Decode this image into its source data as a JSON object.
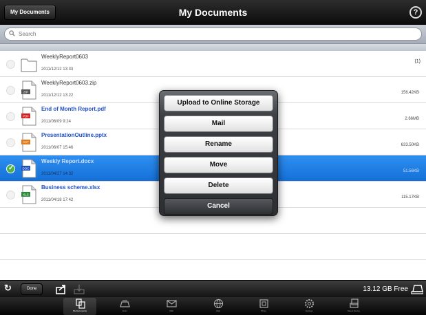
{
  "header": {
    "back_label": "My Documents",
    "title": "My Documents",
    "help_label": "?"
  },
  "search": {
    "placeholder": "Search"
  },
  "files": [
    {
      "name": "WeeklyReport0603",
      "date": "2011/12/12 13:33",
      "size": "",
      "count": "(1)",
      "type": "folder",
      "icon": "folder-icon",
      "selected": false
    },
    {
      "name": "WeeklyReport0603.zip",
      "date": "2011/12/12 13:22",
      "size": "156.42KB",
      "type": "zip",
      "badge": "ZIP",
      "icon": "zip-file-icon",
      "selected": false
    },
    {
      "name": "End of Month Report.pdf",
      "date": "2011/06/09 9:24",
      "size": "2.66MB",
      "type": "pdf",
      "badge": "PDF",
      "icon": "pdf-file-icon",
      "selected": false
    },
    {
      "name": "PresentationOutline.pptx",
      "date": "2011/06/07 15:46",
      "size": "633.50KB",
      "type": "pptx",
      "badge": "PPT",
      "icon": "pptx-file-icon",
      "selected": false
    },
    {
      "name": "Weekly Report.docx",
      "date": "2011/04/27 14:32",
      "size": "51.56KB",
      "type": "docx",
      "badge": "DOC",
      "icon": "docx-file-icon",
      "selected": true
    },
    {
      "name": "Business scheme.xlsx",
      "date": "2011/04/18 17:42",
      "size": "115.17KB",
      "type": "xlsx",
      "badge": "XLS",
      "icon": "xlsx-file-icon",
      "selected": false
    }
  ],
  "popup": {
    "upload_label": "Upload to Online Storage",
    "mail_label": "Mail",
    "rename_label": "Rename",
    "move_label": "Move",
    "delete_label": "Delete",
    "cancel_label": "Cancel"
  },
  "toolbar": {
    "refresh_icon": "refresh-icon",
    "done_label": "Done",
    "share_icon": "share-icon",
    "download_icon": "download-icon",
    "free_space": "13.12 GB Free",
    "drive_icon": "drive-icon"
  },
  "tabs": [
    {
      "label": "My Documents",
      "icon": "documents-tab-icon",
      "active": true
    },
    {
      "label": "Scan",
      "icon": "scan-tab-icon",
      "active": false
    },
    {
      "label": "Mail",
      "icon": "mail-tab-icon",
      "active": false
    },
    {
      "label": "Web",
      "icon": "web-tab-icon",
      "active": false
    },
    {
      "label": "Photo",
      "icon": "photo-tab-icon",
      "active": false
    },
    {
      "label": "Settings",
      "icon": "settings-tab-icon",
      "active": false
    },
    {
      "label": "Select Device",
      "icon": "device-tab-icon",
      "active": false
    }
  ],
  "colors": {
    "selection_blue": "#1a78e0",
    "title_blue": "#1f4fd0",
    "check_green": "#4db247",
    "bar_black": "#111111"
  }
}
